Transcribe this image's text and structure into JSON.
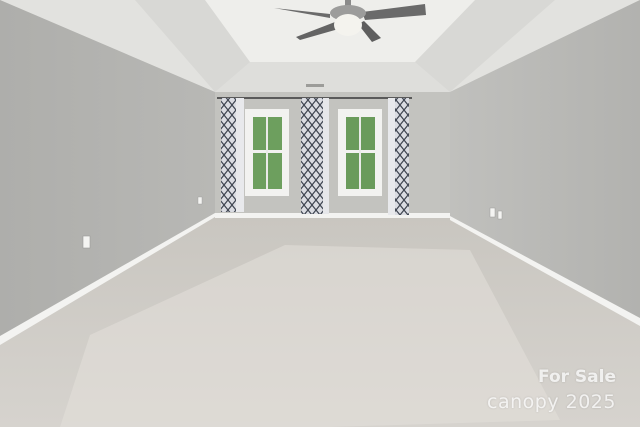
{
  "photo": {
    "subject": "empty carpeted bedroom with tray ceiling and ceiling fan",
    "colors": {
      "wall": "#b9b9b5",
      "wall_far": "#c4c4c0",
      "ceiling": "#e6e6e3",
      "carpet": "#cfcbc5",
      "trim": "#f4f4f2",
      "window_glass": "#6a9e5a",
      "curtain": "#d9dbe0",
      "curtain_pattern": "#3e4450"
    }
  },
  "watermark": {
    "line1": "For Sale",
    "line2": "canopy 2025"
  }
}
